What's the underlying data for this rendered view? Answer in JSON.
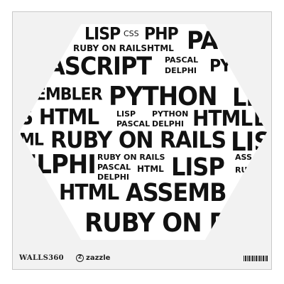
{
  "words": [
    "LISP",
    "CSS",
    "PHP",
    "PA",
    "RUBY ON RAILS",
    "HTML",
    "ASCRIPT",
    "PASCAL",
    "DELPHI",
    "PY",
    "SEMBLER",
    "PYTHON",
    "LI",
    "S HTML",
    "LISP",
    "PASCAL",
    "PYTHON",
    "DELPHI",
    "HTML",
    "LI",
    "ML",
    "RUBY ON RAILS",
    "LIS",
    "ELPHI",
    "RUBY ON RAILS",
    "PASCAL",
    "DELPHI",
    "HTML",
    "LISP",
    "ASS",
    "RUBY O",
    "HTML",
    "ASSEMB",
    "RUBY ON R"
  ],
  "footer": {
    "brand": "WALLS360",
    "zazzle_mark": "Z",
    "zazzle": "zazzle"
  },
  "colors": {
    "ink": "#111111",
    "card_bg": "#f2f2f2",
    "border": "#c8c8c8"
  }
}
